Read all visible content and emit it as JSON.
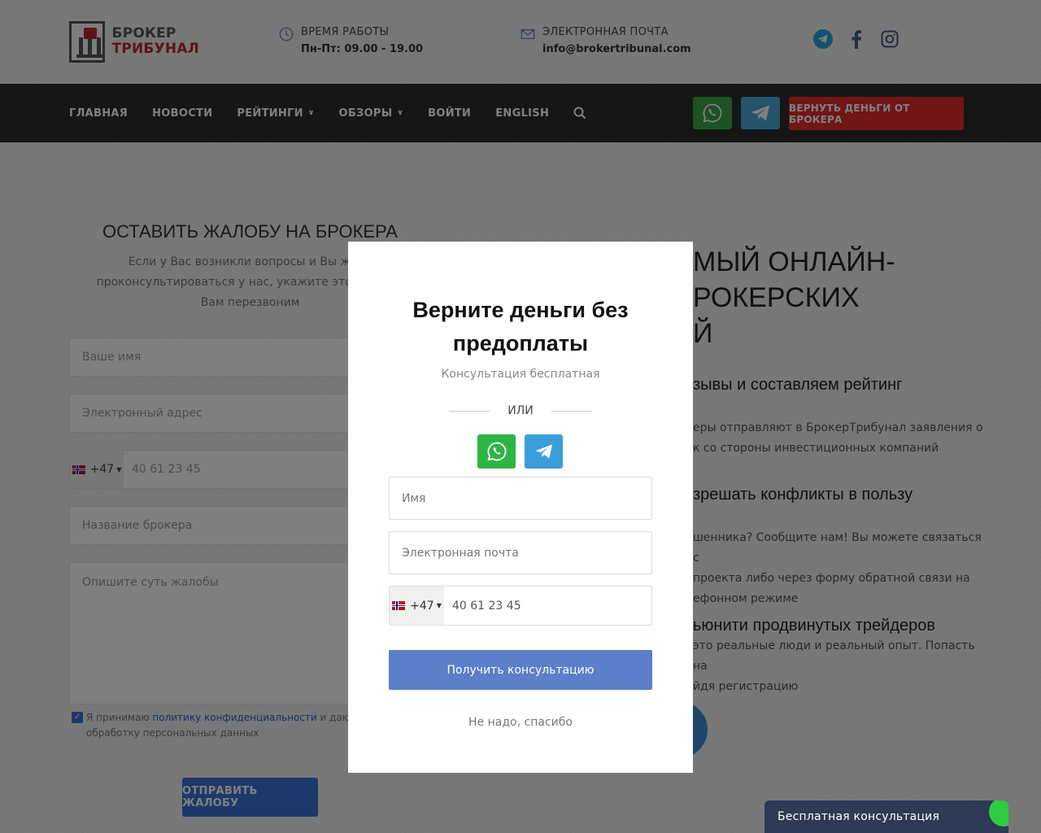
{
  "logo": {
    "line1": "БРОКЕР",
    "line2": "ТРИБУНАЛ"
  },
  "header": {
    "hours_label": "ВРЕМЯ РАБОТЫ",
    "hours_value": "Пн-Пт: 09.00 - 19.00",
    "email_label": "ЭЛЕКТРОННАЯ ПОЧТА",
    "email_value": "info@brokertribunal.com"
  },
  "social": [
    "telegram-icon",
    "facebook-icon",
    "instagram-icon"
  ],
  "nav": {
    "items": [
      {
        "label": "ГЛАВНАЯ",
        "dropdown": false
      },
      {
        "label": "НОВОСТИ",
        "dropdown": false
      },
      {
        "label": "РЕЙТИНГИ",
        "dropdown": true
      },
      {
        "label": "ОБЗОРЫ",
        "dropdown": true
      },
      {
        "label": "ВОЙТИ",
        "dropdown": false
      },
      {
        "label": "ENGLISH",
        "dropdown": false
      }
    ],
    "cta_label": "ВЕРНУТЬ ДЕНЬГИ ОТ БРОКЕРА"
  },
  "complaint_form": {
    "title": "ОСТАВИТЬ ЖАЛОБУ НА БРОКЕРА",
    "subtitle_l1": "Если у Вас возникли вопросы и Вы жела",
    "subtitle_l2": "проконсультироваться у нас, укажите это в теле с",
    "subtitle_l3": "Вам перезвоним",
    "name_placeholder": "Ваше имя",
    "email_placeholder": "Электронный адрес",
    "phone_code": "+47",
    "phone_placeholder": "40 61 23 45",
    "broker_placeholder": "Название брокера",
    "desc_placeholder": "Опишите суть жалобы",
    "consent_prefix": "Я принимаю ",
    "consent_link": "политику конфиденциальности",
    "consent_mid": " и даю сво",
    "consent_l2": "обработку персональных данных",
    "submit_label": "ОТПРАВИТЬ ЖАЛОБУ"
  },
  "right_content": {
    "h1_l1": "МЫЙ ОНЛАЙН-",
    "h1_l2": "РОКЕРСКИХ",
    "h1_l3": "Й",
    "h2_a": "зывы и составляем рейтинг",
    "p_a_l1": "еры отправляют в БрокерТрибунал заявления о",
    "p_a_l2": "к со стороны инвестиционных компаний",
    "h2_b": "зрешать конфликты в пользу",
    "p_b_l1": "шенника? Сообщите нам! Вы можете связаться с",
    "p_b_l2": "проекта либо через форму обратной связи на",
    "p_b_l3": "ефонном режиме",
    "h2_c": "ьюнити продвинутых трейдеров",
    "p_c_l1": "это реальные люди и реальный опыт. Попасть на",
    "p_c_l2": "йдя регистрацию"
  },
  "modal": {
    "title_l1": "Верните деньги без",
    "title_l2": "предоплаты",
    "subtitle": "Консультация бесплатная",
    "or_label": "ИЛИ",
    "name_placeholder": "Имя",
    "email_placeholder": "Электронная почта",
    "phone_code": "+47",
    "phone_placeholder": "40 61 23 45",
    "submit_label": "Получить консультацию",
    "dismiss_label": "Не надо, спасибо"
  },
  "chat_widget": {
    "label": "Бесплатная консультация"
  },
  "colors": {
    "nav_bg": "#2a2a2a",
    "cta_red": "#e22b2b",
    "whatsapp": "#3aa545",
    "telegram": "#49a6d8",
    "modal_submit": "#5b7fc8",
    "chat_bg": "#2e3a56"
  }
}
